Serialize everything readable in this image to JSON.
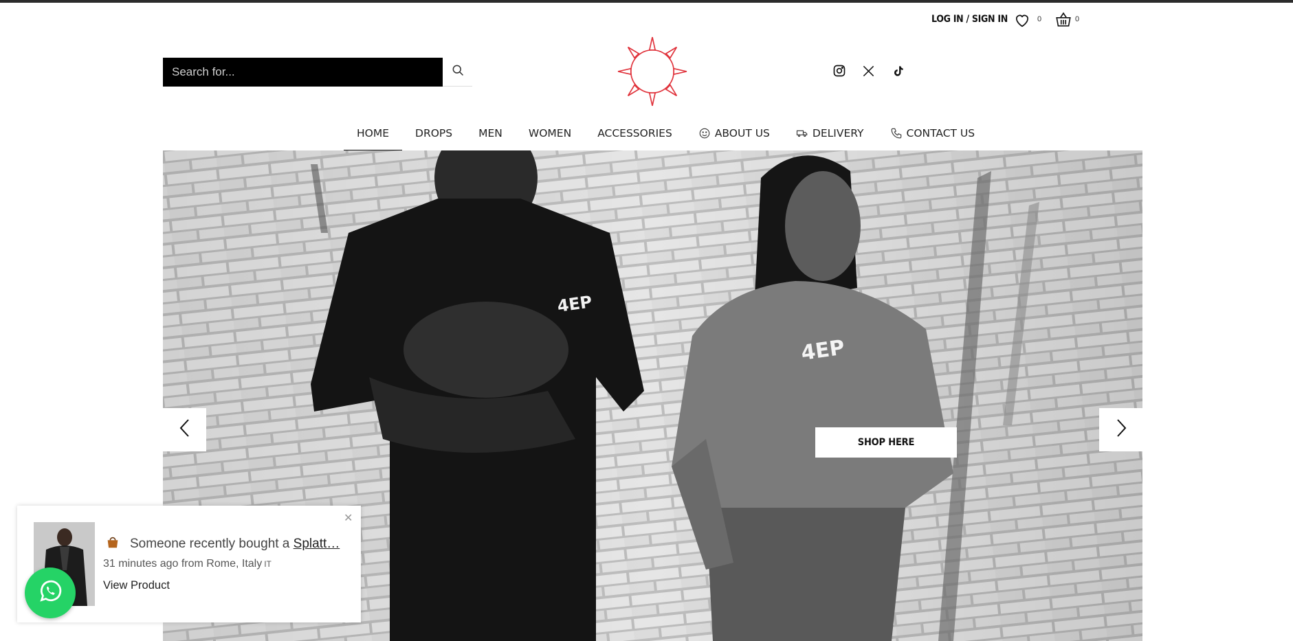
{
  "utility": {
    "login_label": "LOG IN / SIGN IN",
    "wishlist_count": "0",
    "cart_count": "0"
  },
  "search": {
    "placeholder": "Search for..."
  },
  "social": [
    "instagram-icon",
    "x-icon",
    "tiktok-icon"
  ],
  "nav": {
    "items": [
      {
        "label": "HOME",
        "active": true
      },
      {
        "label": "DROPS"
      },
      {
        "label": "MEN"
      },
      {
        "label": "WOMEN"
      },
      {
        "label": "ACCESSORIES"
      },
      {
        "label": "ABOUT US",
        "icon": "smiley-icon"
      },
      {
        "label": "DELIVERY",
        "icon": "truck-icon"
      },
      {
        "label": "CONTACT US",
        "icon": "phone-icon"
      }
    ]
  },
  "hero": {
    "cta_label": "SHOP HERE",
    "shirt_logo": "4EP"
  },
  "popup": {
    "message": "Someone recently bought a ",
    "product_link": "Splatt…",
    "time_location": "31 minutes ago from Rome, Italy",
    "country_code": "IT",
    "view_label": "View Product"
  },
  "colors": {
    "logo_red": "#e0313a",
    "whatsapp_green": "#25d366",
    "search_bg": "#000000"
  }
}
